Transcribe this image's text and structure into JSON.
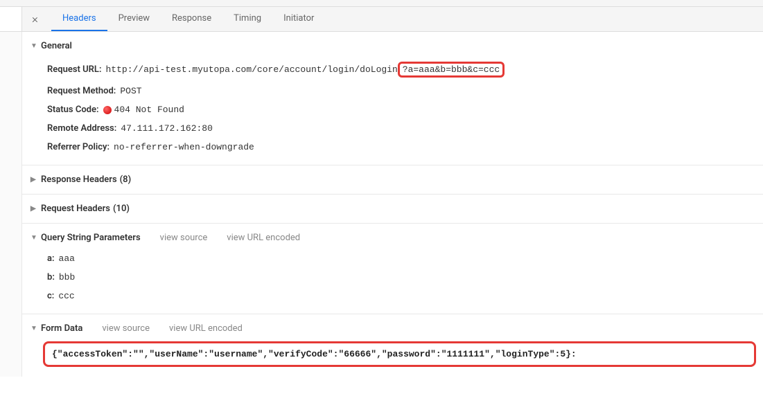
{
  "tabs": {
    "headers": "Headers",
    "preview": "Preview",
    "response": "Response",
    "timing": "Timing",
    "initiator": "Initiator"
  },
  "general": {
    "title": "General",
    "request_url_label": "Request URL:",
    "request_url_base": "http://api-test.myutopa.com/core/account/login/doLogin",
    "request_url_query": "?a=aaa&b=bbb&c=ccc",
    "request_method_label": "Request Method:",
    "request_method_value": "POST",
    "status_code_label": "Status Code:",
    "status_code_value": "404 Not Found",
    "remote_address_label": "Remote Address:",
    "remote_address_value": "47.111.172.162:80",
    "referrer_policy_label": "Referrer Policy:",
    "referrer_policy_value": "no-referrer-when-downgrade"
  },
  "response_headers": {
    "title": "Response Headers",
    "count": "(8)"
  },
  "request_headers": {
    "title": "Request Headers",
    "count": "(10)"
  },
  "query_params": {
    "title": "Query String Parameters",
    "view_source": "view source",
    "view_encoded": "view URL encoded",
    "items": [
      {
        "key": "a:",
        "value": "aaa"
      },
      {
        "key": "b:",
        "value": "bbb"
      },
      {
        "key": "c:",
        "value": "ccc"
      }
    ]
  },
  "form_data": {
    "title": "Form Data",
    "view_source": "view source",
    "view_encoded": "view URL encoded",
    "payload": "{\"accessToken\":\"\",\"userName\":\"username\",\"verifyCode\":\"66666\",\"password\":\"1111111\",\"loginType\":5}:"
  }
}
